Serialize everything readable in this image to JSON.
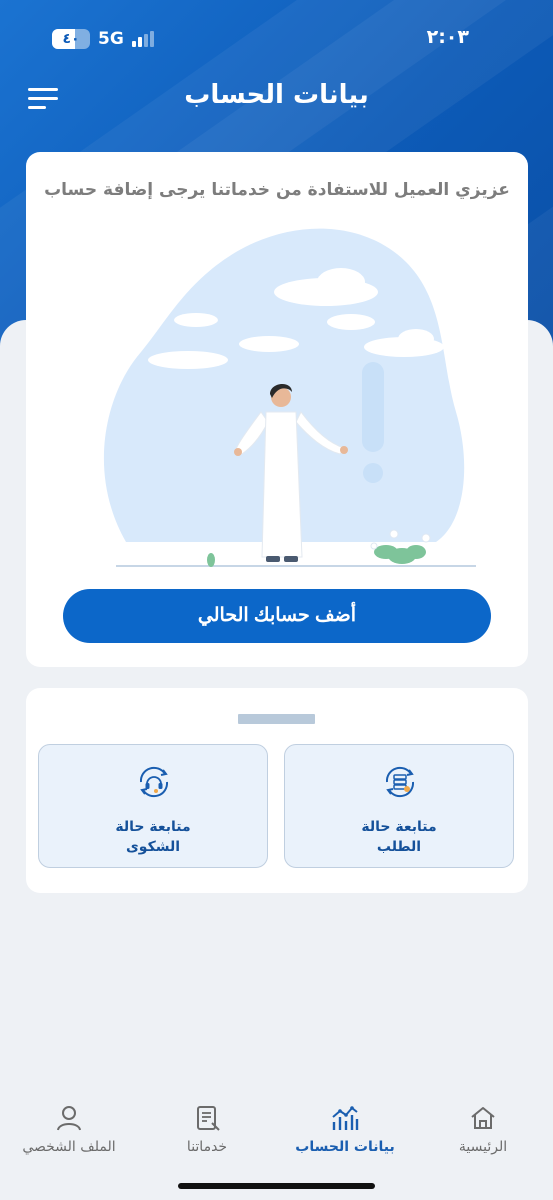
{
  "status_bar": {
    "time": "٢:٠٣",
    "battery": "٤٠",
    "network": "5G"
  },
  "header": {
    "title": "بيانات الحساب"
  },
  "notice": {
    "text": "عزيزي العميل للاستفادة من خدماتنا يرجى إضافة حساب"
  },
  "add_account": {
    "label": "أضف حسابك الحالي"
  },
  "tiles": [
    {
      "line1": "متابعة حالة",
      "line2": "الطلب",
      "icon": "request-status-icon"
    },
    {
      "line1": "متابعة حالة",
      "line2": "الشكوى",
      "icon": "headset-support-icon"
    }
  ],
  "bottom_nav": {
    "items": [
      {
        "label": "الرئيسية",
        "icon": "home-icon",
        "active": false
      },
      {
        "label": "بيانات الحساب",
        "icon": "chart-icon",
        "active": true
      },
      {
        "label": "خدماتنا",
        "icon": "services-icon",
        "active": false
      },
      {
        "label": "الملف الشخصي",
        "icon": "profile-icon",
        "active": false
      }
    ]
  },
  "colors": {
    "primary": "#0c67c9",
    "header_blue": "#1b73d1",
    "active_nav": "#1a5eb0",
    "tile_bg": "#eaf2fb"
  }
}
